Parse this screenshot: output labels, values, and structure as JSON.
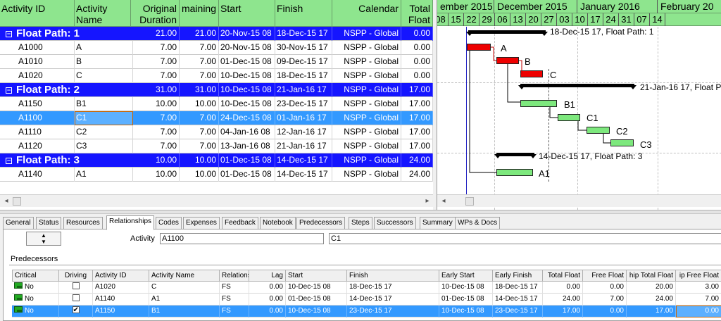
{
  "grid": {
    "headers": {
      "activity_id": "Activity ID",
      "activity_name": "Activity Name",
      "orig_duration": "Original Duration",
      "remaining": "maining",
      "start": "Start",
      "finish": "Finish",
      "calendar": "Calendar",
      "total_float": "Total Float"
    },
    "rows": [
      {
        "type": "group",
        "label": "Float Path: 1",
        "orig": "21.00",
        "rem": "21.00",
        "start": "20-Nov-15 08",
        "finish": "18-Dec-15 17",
        "cal": "NSPP - Global",
        "float": "0.00"
      },
      {
        "type": "row",
        "id": "A1000",
        "name": "A",
        "orig": "7.00",
        "rem": "7.00",
        "start": "20-Nov-15 08",
        "finish": "30-Nov-15 17",
        "cal": "NSPP - Global",
        "float": "0.00"
      },
      {
        "type": "row",
        "id": "A1010",
        "name": "B",
        "orig": "7.00",
        "rem": "7.00",
        "start": "01-Dec-15 08",
        "finish": "09-Dec-15 17",
        "cal": "NSPP - Global",
        "float": "0.00"
      },
      {
        "type": "row",
        "id": "A1020",
        "name": "C",
        "orig": "7.00",
        "rem": "7.00",
        "start": "10-Dec-15 08",
        "finish": "18-Dec-15 17",
        "cal": "NSPP - Global",
        "float": "0.00"
      },
      {
        "type": "group",
        "label": "Float Path: 2",
        "orig": "31.00",
        "rem": "31.00",
        "start": "10-Dec-15 08",
        "finish": "21-Jan-16 17",
        "cal": "NSPP - Global",
        "float": "17.00"
      },
      {
        "type": "row",
        "id": "A1150",
        "name": "B1",
        "orig": "10.00",
        "rem": "10.00",
        "start": "10-Dec-15 08",
        "finish": "23-Dec-15 17",
        "cal": "NSPP - Global",
        "float": "17.00"
      },
      {
        "type": "sel",
        "id": "A1100",
        "name": "C1",
        "orig": "7.00",
        "rem": "7.00",
        "start": "24-Dec-15 08",
        "finish": "01-Jan-16 17",
        "cal": "NSPP - Global",
        "float": "17.00"
      },
      {
        "type": "row",
        "id": "A1110",
        "name": "C2",
        "orig": "7.00",
        "rem": "7.00",
        "start": "04-Jan-16 08",
        "finish": "12-Jan-16 17",
        "cal": "NSPP - Global",
        "float": "17.00"
      },
      {
        "type": "row",
        "id": "A1120",
        "name": "C3",
        "orig": "7.00",
        "rem": "7.00",
        "start": "13-Jan-16 08",
        "finish": "21-Jan-16 17",
        "cal": "NSPP - Global",
        "float": "17.00"
      },
      {
        "type": "group",
        "label": "Float Path: 3",
        "orig": "10.00",
        "rem": "10.00",
        "start": "01-Dec-15 08",
        "finish": "14-Dec-15 17",
        "cal": "NSPP - Global",
        "float": "24.00"
      },
      {
        "type": "row",
        "id": "A1140",
        "name": "A1",
        "orig": "10.00",
        "rem": "10.00",
        "start": "01-Dec-15 08",
        "finish": "14-Dec-15 17",
        "cal": "NSPP - Global",
        "float": "24.00"
      }
    ]
  },
  "gantt": {
    "months": [
      "ember 2015",
      "December 2015",
      "January 2016",
      "February 20"
    ],
    "weeks": [
      "08",
      "15",
      "22",
      "29",
      "06",
      "13",
      "20",
      "27",
      "03",
      "10",
      "17",
      "24",
      "31",
      "07",
      "14"
    ],
    "labels": {
      "fp1": "18-Dec-15 17, Float Path: 1",
      "a": "A",
      "b": "B",
      "c": "C",
      "fp2": "21-Jan-16 17, Float Path: 2",
      "b1": "B1",
      "c1": "C1",
      "c2": "C2",
      "c3": "C3",
      "fp3": "14-Dec-15 17, Float Path: 3",
      "a1": "A1"
    }
  },
  "tabs": [
    "General",
    "Status",
    "Resources",
    "Relationships",
    "Codes",
    "Expenses",
    "Feedback",
    "Notebook",
    "Predecessors",
    "Steps",
    "Successors",
    "Summary",
    "WPs & Docs"
  ],
  "active_tab": "Relationships",
  "detail": {
    "activity_label": "Activity",
    "activity_id": "A1100",
    "activity_name": "C1",
    "section": "Predecessors",
    "headers": {
      "critical": "Critical",
      "driving": "Driving",
      "activity_id": "Activity ID",
      "activity_name": "Activity Name",
      "relation": "Relations",
      "lag": "Lag",
      "start": "Start",
      "finish": "Finish",
      "early_start": "Early Start",
      "early_finish": "Early Finish",
      "total_float": "Total Float",
      "free_float": "Free Float",
      "path_total_float": "hip Total Float",
      "path_free_float": "ip Free Float"
    },
    "rows": [
      {
        "critical": "No",
        "driving": false,
        "id": "A1020",
        "name": "C",
        "rel": "FS",
        "lag": "0.00",
        "start": "10-Dec-15 08",
        "finish": "18-Dec-15 17",
        "es": "10-Dec-15 08",
        "ef": "18-Dec-15 17",
        "tf": "0.00",
        "ff": "0.00",
        "ptf": "20.00",
        "pff": "3.00"
      },
      {
        "critical": "No",
        "driving": false,
        "id": "A1140",
        "name": "A1",
        "rel": "FS",
        "lag": "0.00",
        "start": "01-Dec-15 08",
        "finish": "14-Dec-15 17",
        "es": "01-Dec-15 08",
        "ef": "14-Dec-15 17",
        "tf": "24.00",
        "ff": "7.00",
        "ptf": "24.00",
        "pff": "7.00"
      },
      {
        "critical": "No",
        "driving": true,
        "id": "A1150",
        "name": "B1",
        "rel": "FS",
        "lag": "0.00",
        "start": "10-Dec-15 08",
        "finish": "23-Dec-15 17",
        "es": "10-Dec-15 08",
        "ef": "23-Dec-15 17",
        "tf": "17.00",
        "ff": "0.00",
        "ptf": "17.00",
        "pff": "0.00"
      }
    ]
  },
  "colors": {
    "group_bg": "#1515ff",
    "header_bg": "#8ee58e",
    "selection": "#3399ff",
    "critical_bar": "#ee0000",
    "noncritical_bar": "#7de87d"
  }
}
